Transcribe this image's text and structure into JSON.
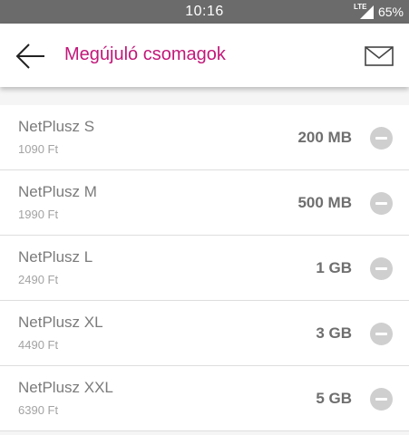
{
  "status_bar": {
    "time": "10:16",
    "network": "LTE",
    "battery": "65%"
  },
  "header": {
    "title": "Megújuló csomagok",
    "title_color": "#c2187a",
    "back_icon": "arrow-left-icon",
    "mail_icon": "envelope-icon"
  },
  "packages": [
    {
      "name": "NetPlusz S",
      "price": "1090 Ft",
      "size": "200 MB"
    },
    {
      "name": "NetPlusz M",
      "price": "1990 Ft",
      "size": "500 MB"
    },
    {
      "name": "NetPlusz L",
      "price": "2490 Ft",
      "size": "1 GB"
    },
    {
      "name": "NetPlusz XL",
      "price": "4490 Ft",
      "size": "3 GB"
    },
    {
      "name": "NetPlusz XXL",
      "price": "6390 Ft",
      "size": "5 GB"
    }
  ],
  "remove_icon": "minus-circle-icon"
}
